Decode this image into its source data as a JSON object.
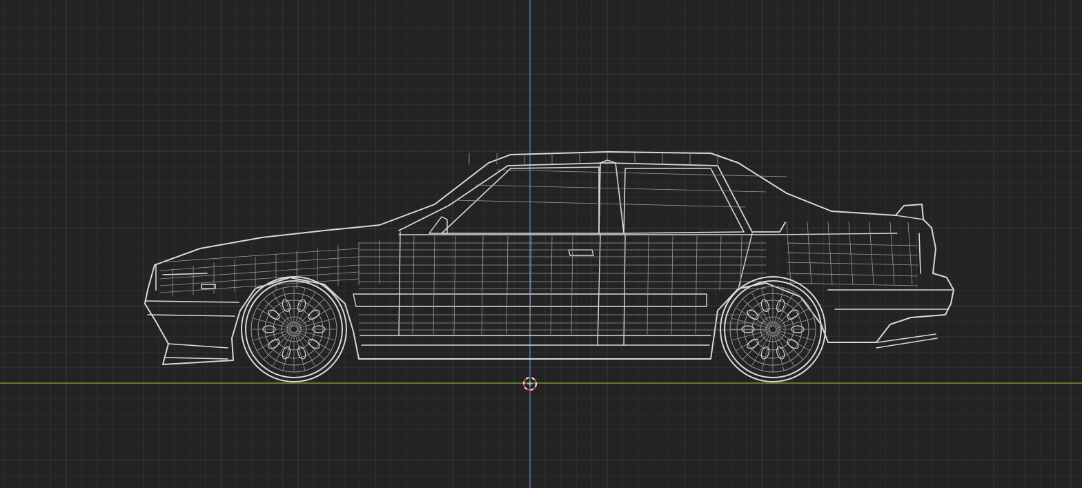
{
  "viewport": {
    "view": "side-orthographic",
    "shading": "wireframe",
    "object": "sedan-car-mesh",
    "icons": {
      "origin": "3d-cursor-icon"
    }
  },
  "colors": {
    "background": "#232323",
    "grid_minor": "#2f2f2f",
    "grid_major": "#3a3a3a",
    "axis_vertical": "#4f7fc2",
    "axis_horizontal": "#6f9a2a",
    "wire": "#d9d9d9",
    "wire_dim": "#9a9a9a",
    "cursor_ring": "#e6e6e6",
    "cursor_accent": "#d43a3a"
  }
}
